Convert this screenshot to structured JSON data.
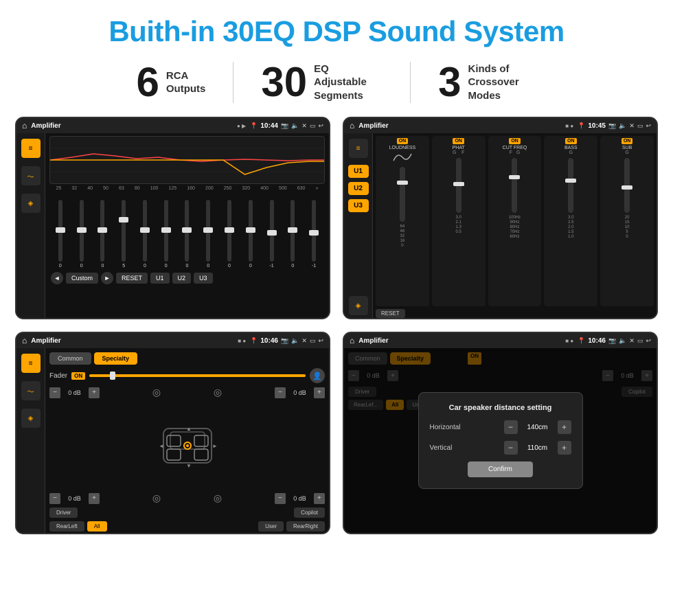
{
  "page": {
    "title": "Buith-in 30EQ DSP Sound System",
    "background": "#ffffff"
  },
  "stats": [
    {
      "number": "6",
      "text": "RCA\nOutputs"
    },
    {
      "number": "30",
      "text": "EQ Adjustable\nSegments"
    },
    {
      "number": "3",
      "text": "Kinds of\nCrossover Modes"
    }
  ],
  "screens": {
    "eq": {
      "title": "Amplifier",
      "time": "10:44",
      "freq_labels": [
        "25",
        "32",
        "40",
        "50",
        "63",
        "80",
        "100",
        "125",
        "160",
        "200",
        "250",
        "320",
        "400",
        "500",
        "630"
      ],
      "slider_values": [
        "0",
        "0",
        "0",
        "5",
        "0",
        "0",
        "0",
        "0",
        "0",
        "0",
        "-1",
        "0",
        "-1"
      ],
      "buttons": [
        "Custom",
        "RESET",
        "U1",
        "U2",
        "U3"
      ]
    },
    "crossover": {
      "title": "Amplifier",
      "time": "10:45",
      "u_buttons": [
        "U1",
        "U2",
        "U3"
      ],
      "columns": [
        "LOUDNESS",
        "PHAT",
        "CUT FREQ",
        "BASS",
        "SUB"
      ],
      "reset_label": "RESET"
    },
    "fader": {
      "title": "Amplifier",
      "time": "10:46",
      "tabs": [
        "Common",
        "Specialty"
      ],
      "fader_label": "Fader",
      "on_label": "ON",
      "volumes": [
        "0 dB",
        "0 dB",
        "0 dB",
        "0 dB"
      ],
      "bottom_btns": [
        "Driver",
        "",
        "Copilot",
        "RearLeft",
        "All",
        "",
        "User",
        "RearRight"
      ]
    },
    "dialog": {
      "title": "Amplifier",
      "time": "10:46",
      "tabs": [
        "Common",
        "Specialty"
      ],
      "on_label": "ON",
      "dialog_title": "Car speaker distance setting",
      "horizontal_label": "Horizontal",
      "horizontal_value": "140cm",
      "vertical_label": "Vertical",
      "vertical_value": "110cm",
      "confirm_label": "Confirm",
      "volumes": [
        "0 dB",
        "0 dB"
      ],
      "bottom_btns": [
        "Driver",
        "Copilot",
        "RearLef...",
        "All",
        "User",
        "RearRight"
      ]
    }
  }
}
